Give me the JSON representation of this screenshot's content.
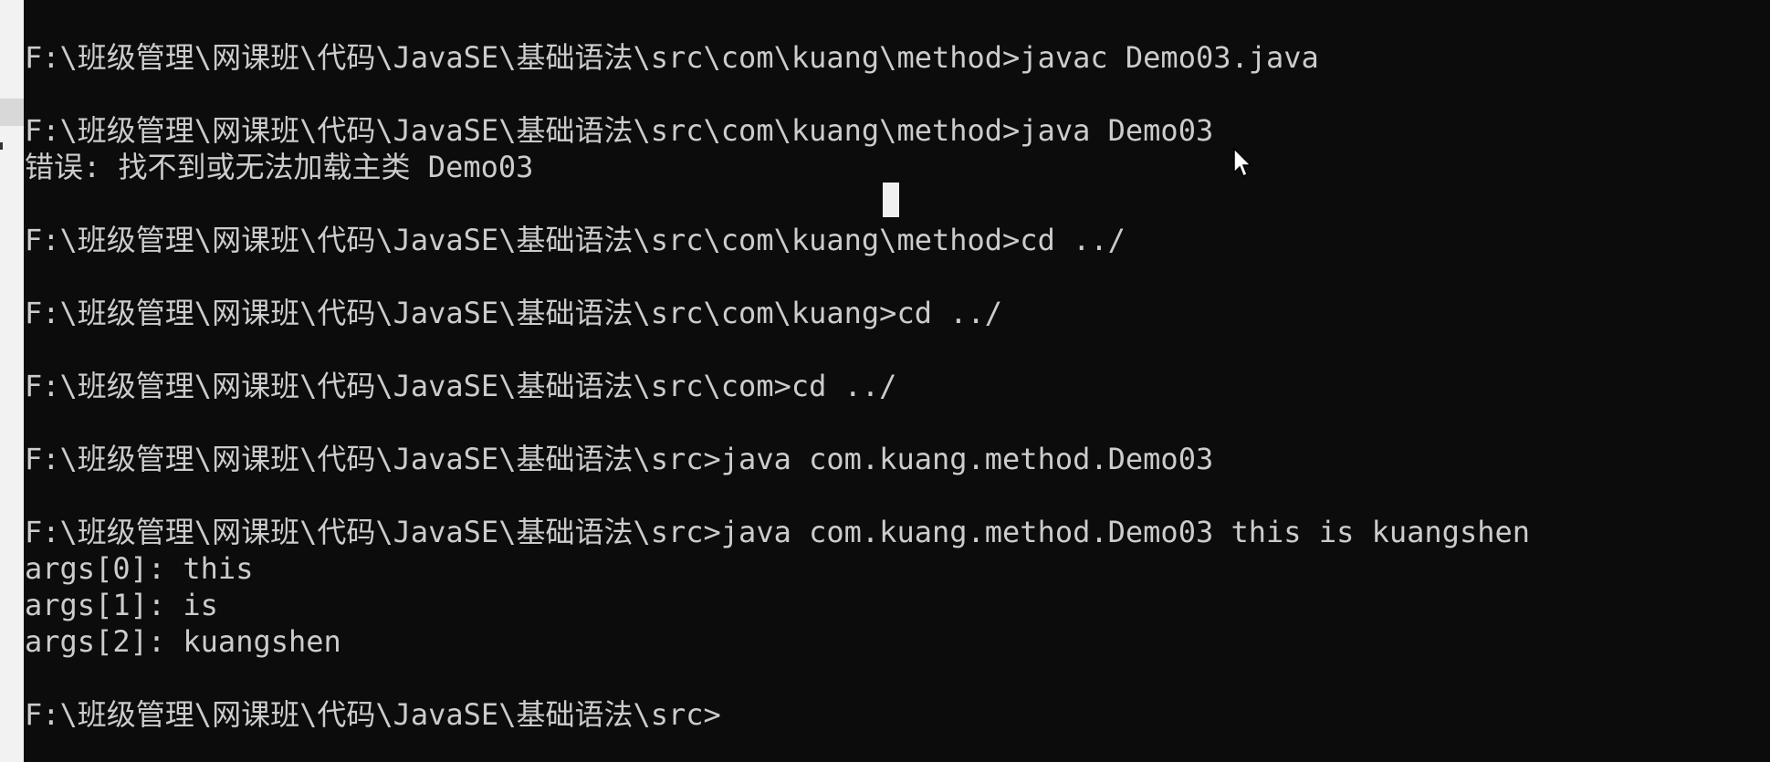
{
  "terminal": {
    "lines": [
      "F:\\班级管理\\网课班\\代码\\JavaSE\\基础语法\\src\\com\\kuang\\method>javac Demo03.java",
      "",
      "F:\\班级管理\\网课班\\代码\\JavaSE\\基础语法\\src\\com\\kuang\\method>java Demo03",
      "错误: 找不到或无法加载主类 Demo03",
      "",
      "F:\\班级管理\\网课班\\代码\\JavaSE\\基础语法\\src\\com\\kuang\\method>cd ../",
      "",
      "F:\\班级管理\\网课班\\代码\\JavaSE\\基础语法\\src\\com\\kuang>cd ../",
      "",
      "F:\\班级管理\\网课班\\代码\\JavaSE\\基础语法\\src\\com>cd ../",
      "",
      "F:\\班级管理\\网课班\\代码\\JavaSE\\基础语法\\src>java com.kuang.method.Demo03",
      "",
      "F:\\班级管理\\网课班\\代码\\JavaSE\\基础语法\\src>java com.kuang.method.Demo03 this is kuangshen",
      "args[0]: this",
      "args[1]: is",
      "args[2]: kuangshen",
      "",
      "F:\\班级管理\\网课班\\代码\\JavaSE\\基础语法\\src>"
    ]
  },
  "colors": {
    "background": "#0c0c0c",
    "text": "#cccccc",
    "cursor": "#f0f0f0"
  },
  "icons": {
    "pointer": "mouse-pointer-icon",
    "cursor": "text-cursor-block"
  }
}
